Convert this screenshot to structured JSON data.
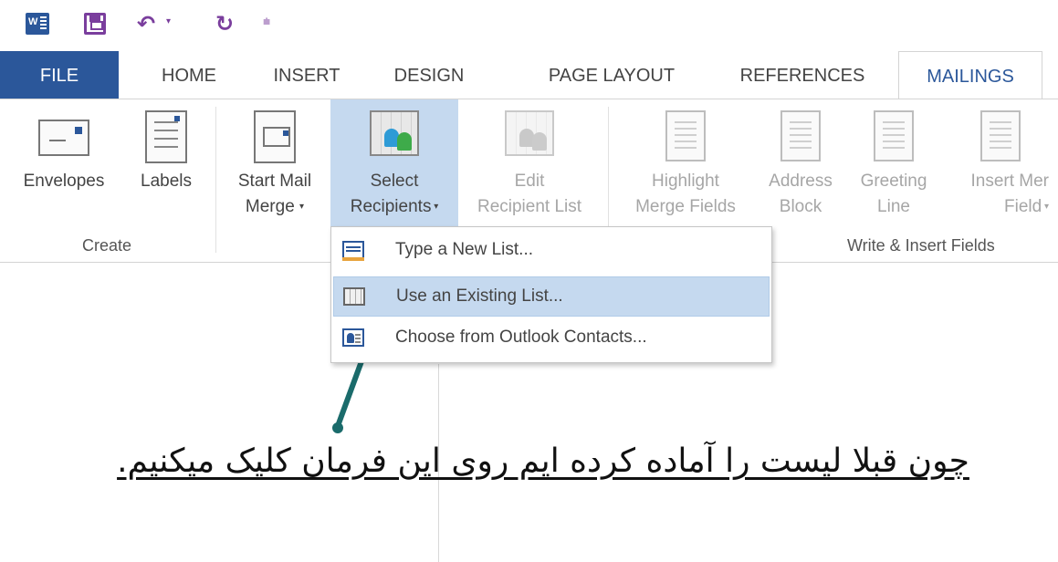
{
  "quick_access": {
    "icons": [
      "word-icon",
      "save-icon",
      "undo-icon",
      "redo-icon",
      "customize-qat-icon"
    ]
  },
  "tabs": [
    "FILE",
    "HOME",
    "INSERT",
    "DESIGN",
    "PAGE LAYOUT",
    "REFERENCES",
    "MAILINGS"
  ],
  "active_tab": "MAILINGS",
  "ribbon": {
    "create": {
      "envelopes": "Envelopes",
      "labels": "Labels",
      "group_label": "Create"
    },
    "start_mail_merge": {
      "line1": "Start Mail",
      "line2": "Merge"
    },
    "select_recipients": {
      "line1": "Select",
      "line2": "Recipients"
    },
    "edit_recipient_list": {
      "line1": "Edit",
      "line2": "Recipient List"
    },
    "write_insert": {
      "highlight": {
        "line1": "Highlight",
        "line2": "Merge Fields"
      },
      "address": {
        "line1": "Address",
        "line2": "Block"
      },
      "greeting": {
        "line1": "Greeting",
        "line2": "Line"
      },
      "insert_merge": {
        "line1": "Insert Mer",
        "line2": "Field"
      },
      "group_label": "Write & Insert Fields"
    }
  },
  "dropdown": {
    "items": [
      {
        "label": "Type a New List...",
        "icon": "type-new-list-icon"
      },
      {
        "label": "Use an Existing List...",
        "icon": "existing-list-icon"
      },
      {
        "label": "Choose from Outlook Contacts...",
        "icon": "outlook-contacts-icon"
      }
    ],
    "highlighted_index": 1
  },
  "document": {
    "note": "چون قبلا لیست را آماده کرده ایم روی این فرمان کلیک میکنیم."
  },
  "colors": {
    "word_blue": "#2b579a",
    "qat_purple": "#7a3e9d",
    "selection_blue": "#c5d9ef",
    "arrow_teal": "#1a6b6b"
  }
}
